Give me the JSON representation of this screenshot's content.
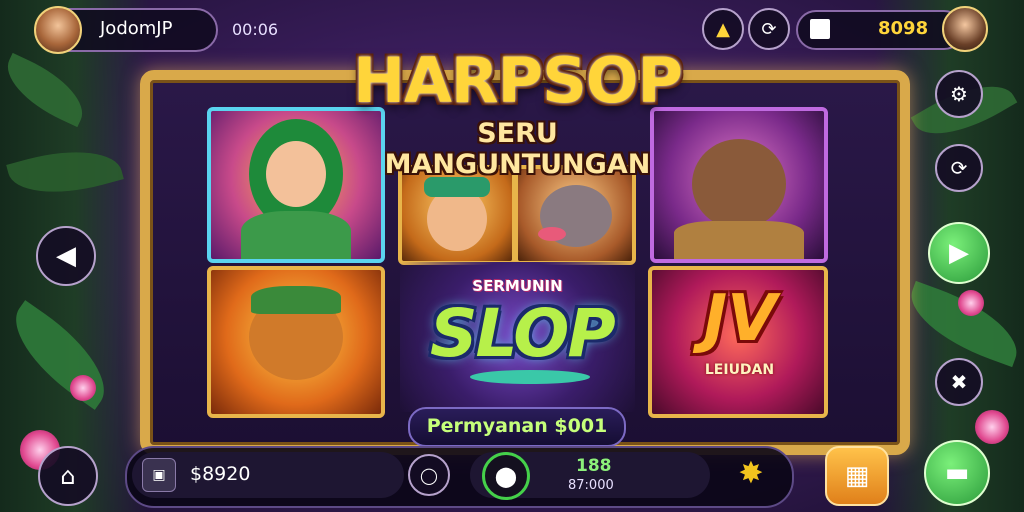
{
  "header": {
    "username": "JodomJP",
    "timer": "00:06",
    "balance": "8098"
  },
  "title": {
    "main": "HARPSOP",
    "sub": "SERU MANGUNTUNGAN"
  },
  "tiles": {
    "slot_overline": "SERMUNIN",
    "slot_word": "SLOP",
    "jv_word": "JV",
    "jv_caption": "LEIUDAN"
  },
  "banner": {
    "text": "Permyanan $001"
  },
  "footer": {
    "wallet": "$8920",
    "count": "188",
    "total": "87:000"
  },
  "colors": {
    "accent_gold": "#ffd53a",
    "frame_gold": "#d9a94a",
    "play_green": "#35c24a",
    "menu_orange": "#f2a21e"
  },
  "icons": {
    "hint": "lightbulb-icon",
    "refresh": "refresh-icon",
    "wallet": "wallet-icon",
    "settings": "gear-icon",
    "sync": "sync-icon",
    "prev": "arrow-left-icon",
    "next": "play-icon",
    "tools": "tools-icon",
    "home": "home-icon",
    "turbo": "turbo-icon",
    "spin": "spin-icon",
    "bonus": "star-badge-icon",
    "menu": "grid-menu-icon",
    "bet": "bone-icon"
  }
}
